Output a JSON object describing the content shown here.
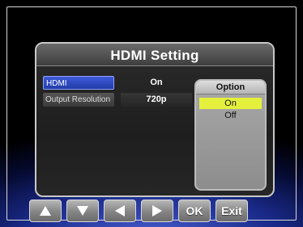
{
  "panel": {
    "title": "HDMI Setting",
    "rows": [
      {
        "label": "HDMI",
        "value": "On",
        "selected": true
      },
      {
        "label": "Output Resolution",
        "value": "720p",
        "selected": false
      }
    ]
  },
  "option": {
    "title": "Option",
    "items": [
      {
        "label": "On",
        "active": true
      },
      {
        "label": "Off",
        "active": false
      }
    ]
  },
  "buttons": {
    "up": {
      "icon": "arrow-up-icon"
    },
    "down": {
      "icon": "arrow-down-icon"
    },
    "left": {
      "icon": "arrow-left-icon"
    },
    "right": {
      "icon": "arrow-right-icon"
    },
    "ok": {
      "label": "OK"
    },
    "exit": {
      "label": "Exit"
    }
  },
  "colors": {
    "selected_row": "#2f4bc4",
    "active_option": "#e4f03c",
    "background_glow": "#4a5fd0"
  }
}
